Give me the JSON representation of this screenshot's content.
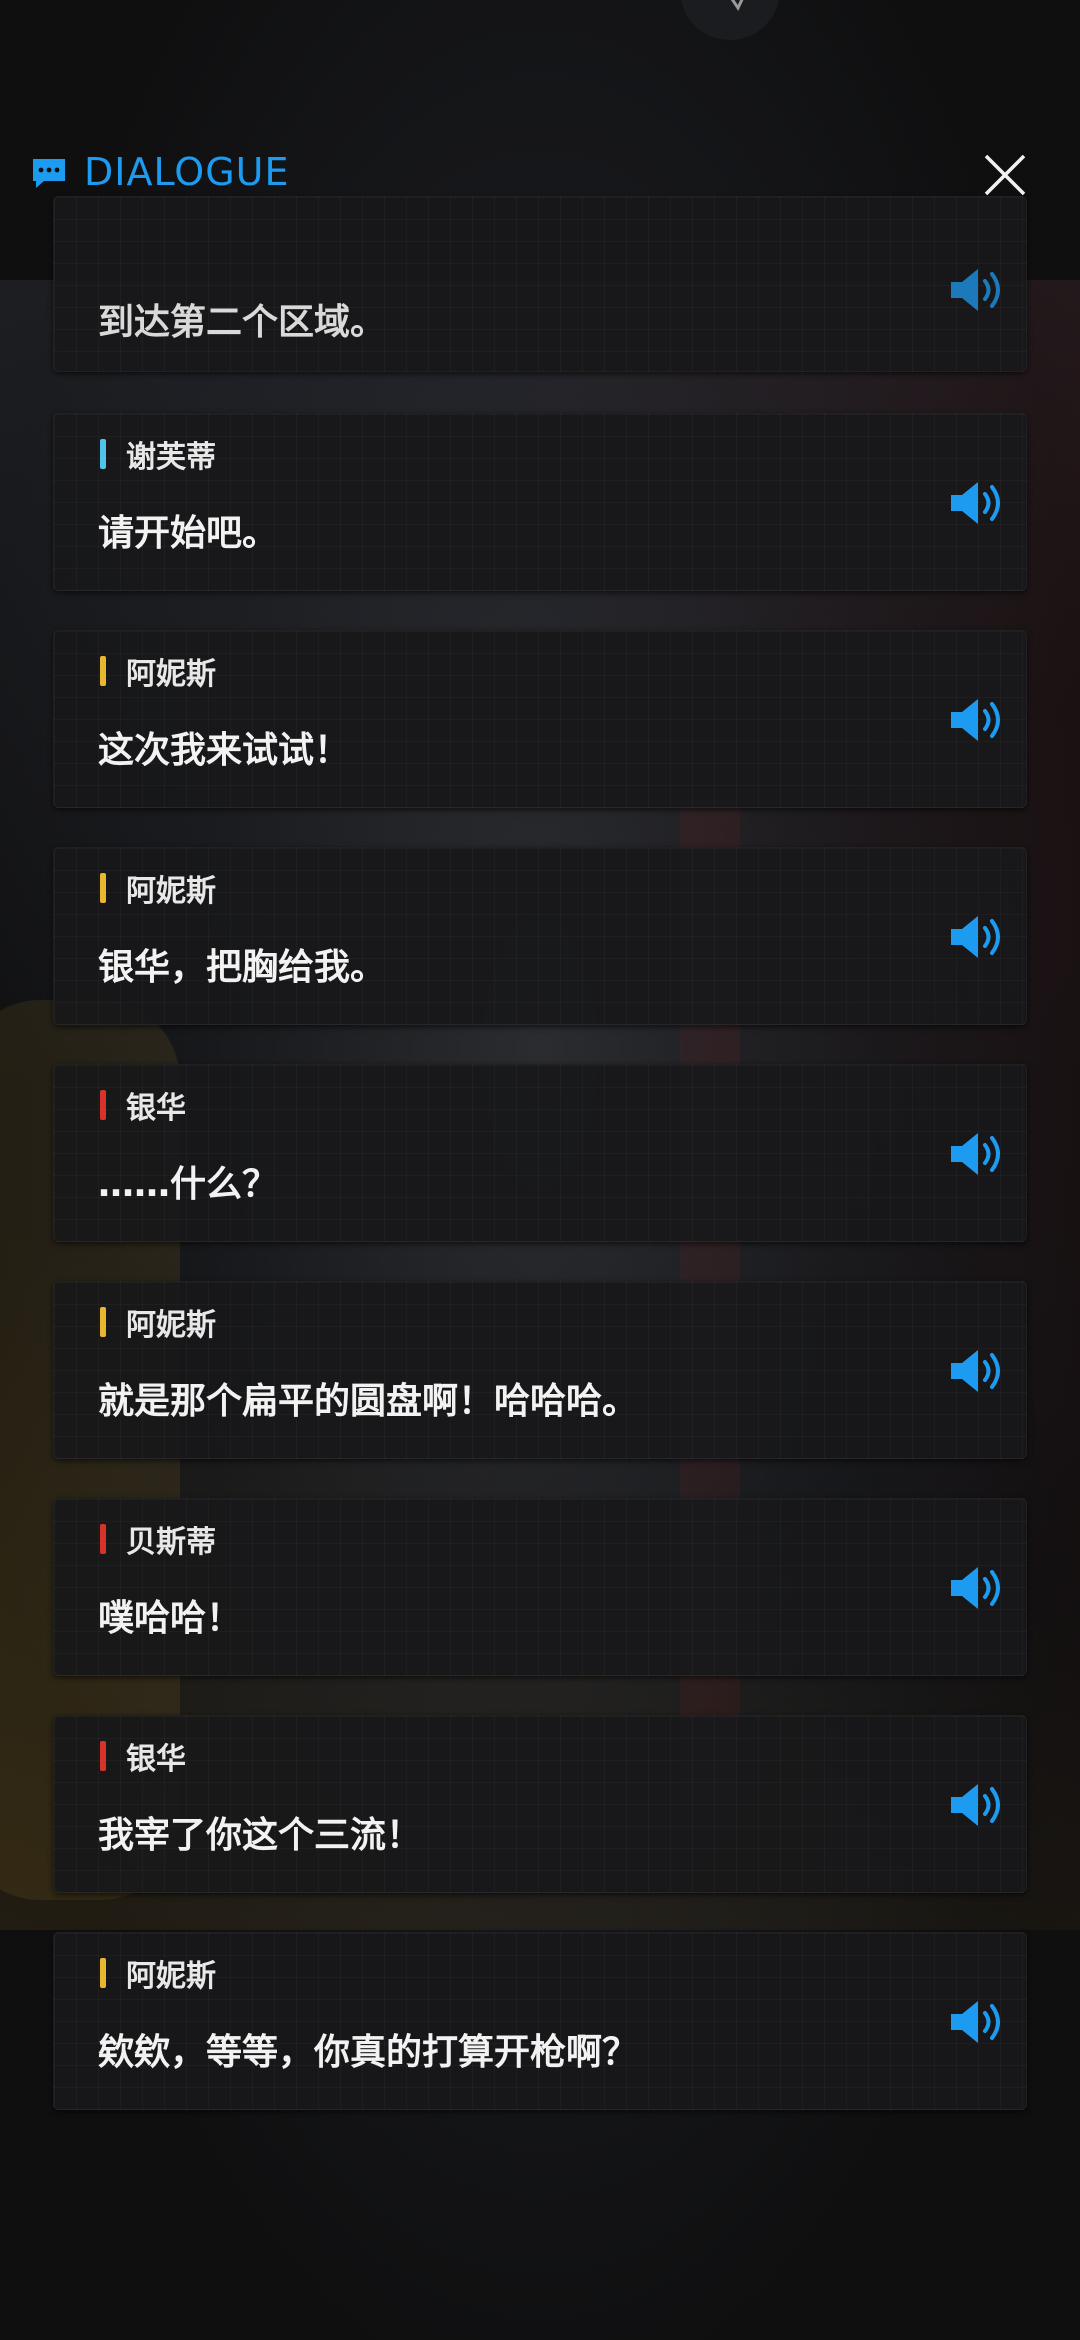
{
  "header": {
    "title": "DIALOGUE",
    "accent_color": "#1d9bf0",
    "icon": "chat-bubble-icon",
    "close_icon": "close-icon"
  },
  "colors": {
    "cyan": "#4fc3e8",
    "yellow": "#e9b72e",
    "red": "#d8332b",
    "voice": "#1d9bf0"
  },
  "dialogue": [
    {
      "speaker": "",
      "bar_color": "",
      "text": "到达第二个区域。",
      "voice_icon": "speaker-volume-icon"
    },
    {
      "speaker": "谢芙蒂",
      "bar_color": "#4fc3e8",
      "text": "请开始吧。",
      "voice_icon": "speaker-volume-icon"
    },
    {
      "speaker": "阿妮斯",
      "bar_color": "#e9b72e",
      "text": "这次我来试试！",
      "voice_icon": "speaker-volume-icon"
    },
    {
      "speaker": "阿妮斯",
      "bar_color": "#e9b72e",
      "text": "银华，把胸给我。",
      "voice_icon": "speaker-volume-icon"
    },
    {
      "speaker": "银华",
      "bar_color": "#d8332b",
      "text": "……什么？",
      "voice_icon": "speaker-volume-icon"
    },
    {
      "speaker": "阿妮斯",
      "bar_color": "#e9b72e",
      "text": "就是那个扁平的圆盘啊！哈哈哈。",
      "voice_icon": "speaker-volume-icon"
    },
    {
      "speaker": "贝斯蒂",
      "bar_color": "#d8332b",
      "text": "噗哈哈！",
      "voice_icon": "speaker-volume-icon"
    },
    {
      "speaker": "银华",
      "bar_color": "#d8332b",
      "text": "我宰了你这个三流！",
      "voice_icon": "speaker-volume-icon"
    },
    {
      "speaker": "阿妮斯",
      "bar_color": "#e9b72e",
      "text": "欸欸，等等，你真的打算开枪啊？",
      "voice_icon": "speaker-volume-icon"
    }
  ]
}
